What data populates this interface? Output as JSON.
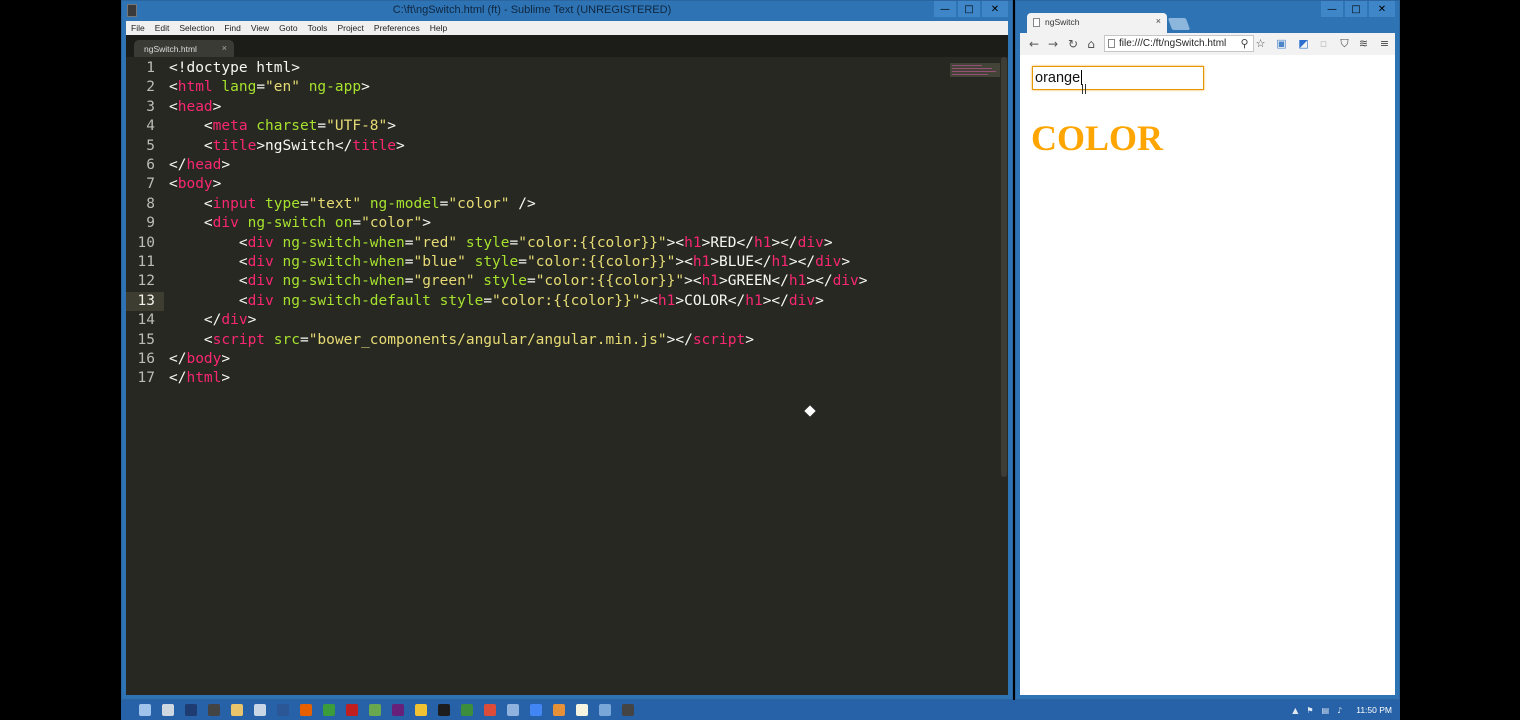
{
  "sublime": {
    "title": "C:\\ft\\ngSwitch.html (ft) - Sublime Text (UNREGISTERED)",
    "menu": [
      "File",
      "Edit",
      "Selection",
      "Find",
      "View",
      "Goto",
      "Tools",
      "Project",
      "Preferences",
      "Help"
    ],
    "tab_label": "ngSwitch.html",
    "tab_close": "×",
    "active_line": 13,
    "lines": [
      [
        [
          "pl",
          "<!doctype html>"
        ]
      ],
      [
        [
          "pl",
          "<"
        ],
        [
          "tg",
          "html"
        ],
        [
          "at",
          " lang"
        ],
        [
          "pl",
          "="
        ],
        [
          "st",
          "\"en\""
        ],
        [
          "at",
          " ng-app"
        ],
        [
          "pl",
          ">"
        ]
      ],
      [
        [
          "pl",
          "<"
        ],
        [
          "tg",
          "head"
        ],
        [
          "pl",
          ">"
        ]
      ],
      [
        [
          "pl",
          "    <"
        ],
        [
          "tg",
          "meta"
        ],
        [
          "at",
          " charset"
        ],
        [
          "pl",
          "="
        ],
        [
          "st",
          "\"UTF-8\""
        ],
        [
          "pl",
          ">"
        ]
      ],
      [
        [
          "pl",
          "    <"
        ],
        [
          "tg",
          "title"
        ],
        [
          "pl",
          ">ngSwitch</"
        ],
        [
          "tg",
          "title"
        ],
        [
          "pl",
          ">"
        ]
      ],
      [
        [
          "pl",
          "</"
        ],
        [
          "tg",
          "head"
        ],
        [
          "pl",
          ">"
        ]
      ],
      [
        [
          "pl",
          "<"
        ],
        [
          "tg",
          "body"
        ],
        [
          "pl",
          ">"
        ]
      ],
      [
        [
          "pl",
          "    <"
        ],
        [
          "tg",
          "input"
        ],
        [
          "at",
          " type"
        ],
        [
          "pl",
          "="
        ],
        [
          "st",
          "\"text\""
        ],
        [
          "at",
          " ng-model"
        ],
        [
          "pl",
          "="
        ],
        [
          "st",
          "\"color\""
        ],
        [
          "pl",
          " />"
        ]
      ],
      [
        [
          "pl",
          "    <"
        ],
        [
          "tg",
          "div"
        ],
        [
          "at",
          " ng-switch on"
        ],
        [
          "pl",
          "="
        ],
        [
          "st",
          "\"color\""
        ],
        [
          "pl",
          ">"
        ]
      ],
      [
        [
          "pl",
          "        <"
        ],
        [
          "tg",
          "div"
        ],
        [
          "at",
          " ng-switch-when"
        ],
        [
          "pl",
          "="
        ],
        [
          "st",
          "\"red\""
        ],
        [
          "at",
          " style"
        ],
        [
          "pl",
          "="
        ],
        [
          "st",
          "\"color:{{color}}\""
        ],
        [
          "pl",
          "><"
        ],
        [
          "tg",
          "h1"
        ],
        [
          "pl",
          ">RED</"
        ],
        [
          "tg",
          "h1"
        ],
        [
          "pl",
          "></"
        ],
        [
          "tg",
          "div"
        ],
        [
          "pl",
          ">"
        ]
      ],
      [
        [
          "pl",
          "        <"
        ],
        [
          "tg",
          "div"
        ],
        [
          "at",
          " ng-switch-when"
        ],
        [
          "pl",
          "="
        ],
        [
          "st",
          "\"blue\""
        ],
        [
          "at",
          " style"
        ],
        [
          "pl",
          "="
        ],
        [
          "st",
          "\"color:{{color}}\""
        ],
        [
          "pl",
          "><"
        ],
        [
          "tg",
          "h1"
        ],
        [
          "pl",
          ">BLUE</"
        ],
        [
          "tg",
          "h1"
        ],
        [
          "pl",
          "></"
        ],
        [
          "tg",
          "div"
        ],
        [
          "pl",
          ">"
        ]
      ],
      [
        [
          "pl",
          "        <"
        ],
        [
          "tg",
          "div"
        ],
        [
          "at",
          " ng-switch-when"
        ],
        [
          "pl",
          "="
        ],
        [
          "st",
          "\"green\""
        ],
        [
          "at",
          " style"
        ],
        [
          "pl",
          "="
        ],
        [
          "st",
          "\"color:{{color}}\""
        ],
        [
          "pl",
          "><"
        ],
        [
          "tg",
          "h1"
        ],
        [
          "pl",
          ">GREEN</"
        ],
        [
          "tg",
          "h1"
        ],
        [
          "pl",
          "></"
        ],
        [
          "tg",
          "div"
        ],
        [
          "pl",
          ">"
        ]
      ],
      [
        [
          "pl",
          "        <"
        ],
        [
          "tg",
          "div"
        ],
        [
          "at",
          " ng-switch-default"
        ],
        [
          "at",
          " style"
        ],
        [
          "pl",
          "="
        ],
        [
          "st",
          "\"color:{{color}}\""
        ],
        [
          "pl",
          "><"
        ],
        [
          "tg",
          "h1"
        ],
        [
          "pl",
          ">COLOR</"
        ],
        [
          "tg",
          "h1"
        ],
        [
          "pl",
          "></"
        ],
        [
          "tg",
          "div"
        ],
        [
          "pl",
          ">"
        ]
      ],
      [
        [
          "pl",
          "    </"
        ],
        [
          "tg",
          "div"
        ],
        [
          "pl",
          ">"
        ]
      ],
      [
        [
          "pl",
          "    <"
        ],
        [
          "tg",
          "script"
        ],
        [
          "at",
          " src"
        ],
        [
          "pl",
          "="
        ],
        [
          "st",
          "\"bower_components/angular/angular.min.js\""
        ],
        [
          "pl",
          "></"
        ],
        [
          "tg",
          "script"
        ],
        [
          "pl",
          ">"
        ]
      ],
      [
        [
          "pl",
          "</"
        ],
        [
          "tg",
          "body"
        ],
        [
          "pl",
          ">"
        ]
      ],
      [
        [
          "pl",
          "</"
        ],
        [
          "tg",
          "html"
        ],
        [
          "pl",
          ">"
        ]
      ]
    ]
  },
  "chrome": {
    "tab_label": "ngSwitch",
    "tab_close": "×",
    "url": "file:///C:/ft/ngSwitch.html",
    "input_value": "orange",
    "heading": "COLOR",
    "heading_color": "#ffa500"
  },
  "window_buttons": {
    "minimize": "—",
    "maximize": "□",
    "close": "✕"
  },
  "taskbar": {
    "clock": "11:50 PM",
    "icons": [
      {
        "name": "start-icon",
        "color": "#9fc3ea"
      },
      {
        "name": "search-icon",
        "color": "#cfd8e0"
      },
      {
        "name": "terminal-icon",
        "color": "#1e3c72"
      },
      {
        "name": "sublime-icon",
        "color": "#444444"
      },
      {
        "name": "folder-icon",
        "color": "#e9c46a"
      },
      {
        "name": "files-icon",
        "color": "#c9d6e6"
      },
      {
        "name": "powershell-icon",
        "color": "#2b5797"
      },
      {
        "name": "firefox-icon",
        "color": "#e66000"
      },
      {
        "name": "git-icon",
        "color": "#3b9c3b"
      },
      {
        "name": "filezilla-icon",
        "color": "#bf1f1f"
      },
      {
        "name": "tool-icon",
        "color": "#6aa84f"
      },
      {
        "name": "visual-studio-icon",
        "color": "#68217a"
      },
      {
        "name": "notes-icon",
        "color": "#f1c232"
      },
      {
        "name": "pycharm-icon",
        "color": "#1d1d1d"
      },
      {
        "name": "network-icon",
        "color": "#3c8d3c"
      },
      {
        "name": "chrome-icon",
        "color": "#dd4b39"
      },
      {
        "name": "settings-icon",
        "color": "#8fb3de"
      },
      {
        "name": "google-icon",
        "color": "#4285f4"
      },
      {
        "name": "chart-icon",
        "color": "#e69138"
      },
      {
        "name": "notepad-icon",
        "color": "#f4f4e0"
      },
      {
        "name": "paint-icon",
        "color": "#79a7d8"
      },
      {
        "name": "app-icon",
        "color": "#444444"
      }
    ],
    "tray": [
      "▲",
      "⚑",
      "▤",
      "♪"
    ]
  }
}
